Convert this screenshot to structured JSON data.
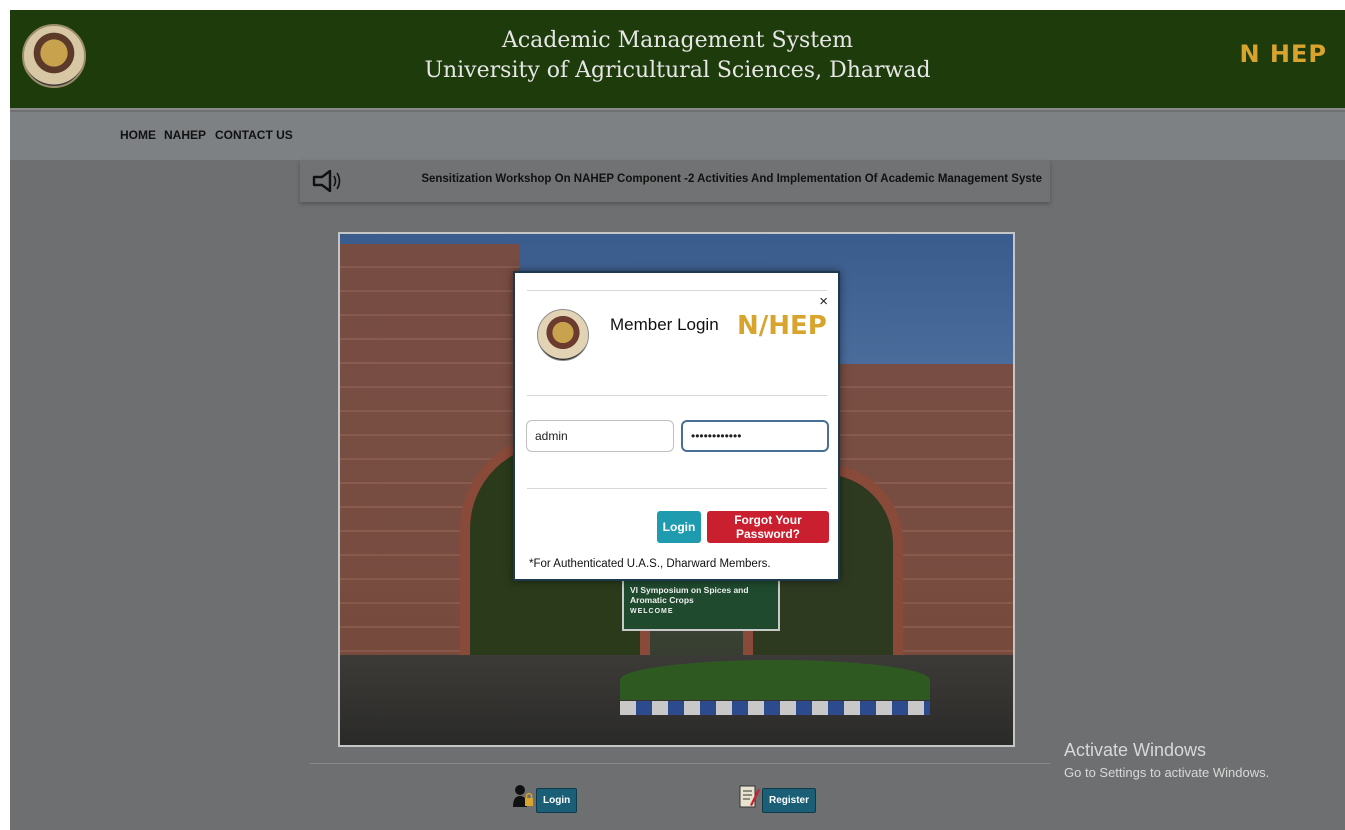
{
  "header": {
    "title_line1": "Academic Management System",
    "title_line2": "University of Agricultural Sciences, Dharwad",
    "brand": "N HEP"
  },
  "nav": {
    "items": [
      "HOME",
      "NAHEP",
      "CONTACT US"
    ]
  },
  "ticker": {
    "text": "Sensitization Workshop On NAHEP Component -2 Activities And Implementation Of Academic Management Syste"
  },
  "campus_banner": {
    "line1": "VI Symposium on Spices and Aromatic Crops",
    "line2": "WELCOME"
  },
  "modal": {
    "title": "Member Login",
    "brand": "N/HEP",
    "close": "×",
    "username_value": "admin",
    "password_value": "••••••••••••",
    "login_label": "Login",
    "forgot_label": "Forgot Your Password?",
    "note": "*For Authenticated U.A.S., Dharward Members."
  },
  "watermark": {
    "line1": "Activate Windows",
    "line2": "Go to Settings to activate Windows."
  },
  "bottom": {
    "login_label": "Login",
    "register_label": "Register"
  },
  "colors": {
    "header_bg": "#1e3b0c",
    "brand_gold": "#d9a42e",
    "login_teal": "#1f9bb0",
    "forgot_red": "#c91f2f"
  }
}
